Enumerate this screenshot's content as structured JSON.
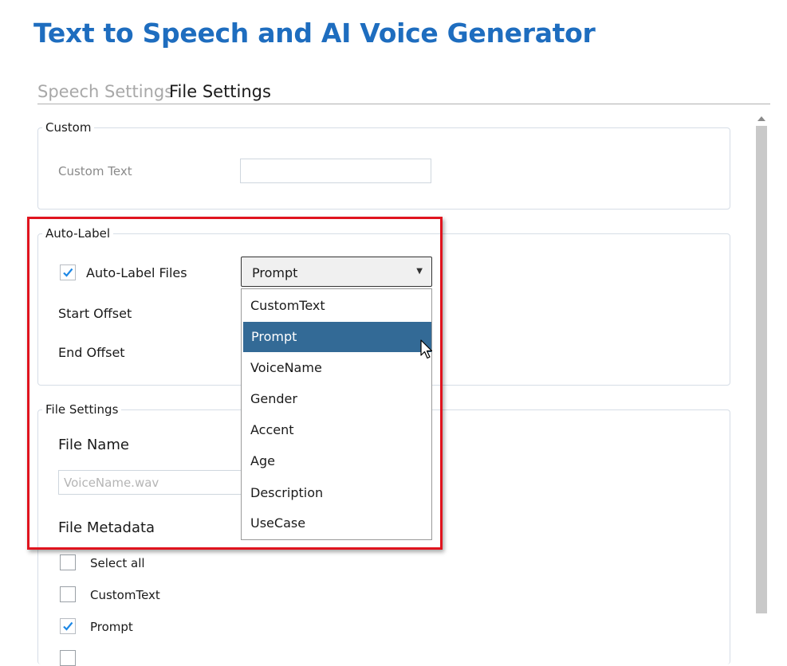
{
  "app": {
    "title": "Text to Speech and AI Voice Generator"
  },
  "tabs": [
    {
      "label": "Speech Settings",
      "active": false
    },
    {
      "label": "File Settings",
      "active": true
    }
  ],
  "custom_group": {
    "title": "Custom",
    "custom_text_label": "Custom Text",
    "custom_text_value": ""
  },
  "auto_label_group": {
    "title": "Auto-Label",
    "auto_label_files": {
      "label": "Auto-Label Files",
      "checked": true
    },
    "selected_value": "Prompt",
    "start_offset_label": "Start Offset",
    "end_offset_label": "End Offset",
    "options": [
      "CustomText",
      "Prompt",
      "VoiceName",
      "Gender",
      "Accent",
      "Age",
      "Description",
      "UseCase"
    ]
  },
  "file_settings_group": {
    "title": "File Settings",
    "file_name_label": "File Name",
    "file_name_placeholder": "VoiceName.wav",
    "file_metadata_label": "File Metadata",
    "metadata_items": [
      {
        "label": "Select all",
        "checked": false
      },
      {
        "label": "CustomText",
        "checked": false
      },
      {
        "label": "Prompt",
        "checked": true
      }
    ]
  },
  "colors": {
    "title_blue": "#1e6dbf",
    "selected_option": "#336a96",
    "highlight_red": "#e0141e",
    "check_blue": "#1e88e5"
  }
}
